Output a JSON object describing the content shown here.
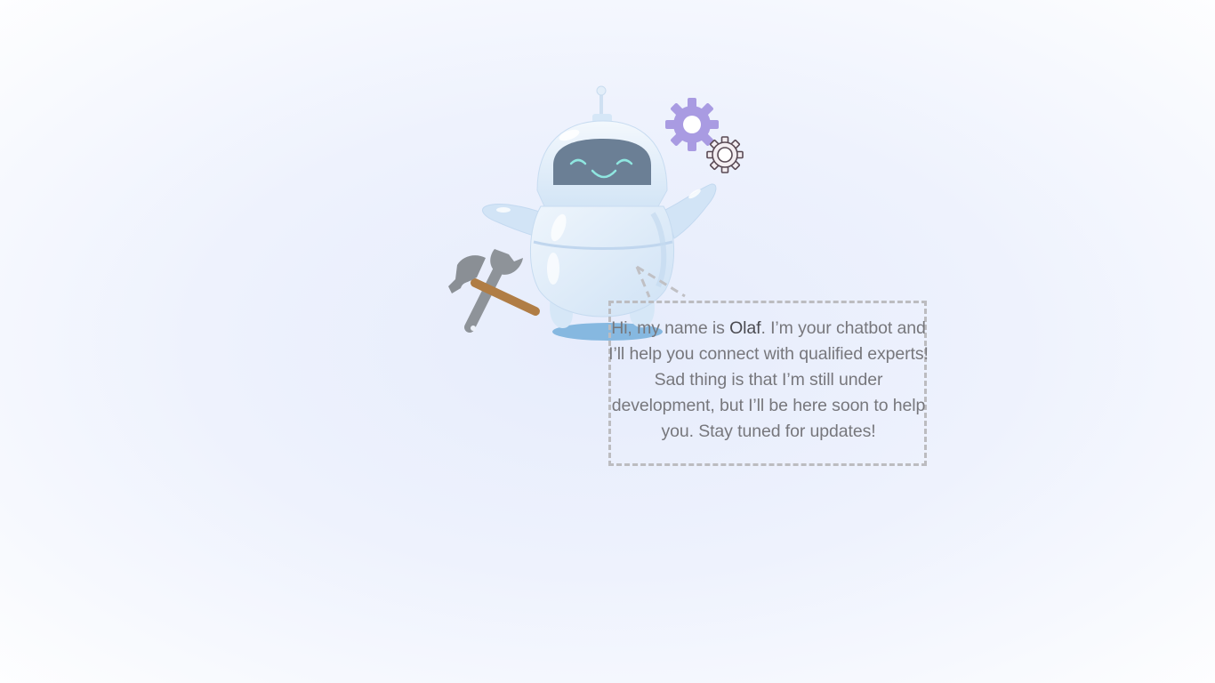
{
  "illustration": {
    "character": "robot",
    "icons": [
      "robot-icon",
      "gear-large-icon",
      "gear-small-icon",
      "hammer-icon",
      "wrench-icon"
    ],
    "colors": {
      "robot_body": "#dbe9f8",
      "robot_visor": "#6b7f95",
      "robot_face": "#8fe6e0",
      "gear_large": "#a99be2",
      "gear_small_outline": "#5a4a55",
      "shadow": "#7fb3dd",
      "hammer_handle": "#b07d45",
      "tools_metal": "#8e9399"
    }
  },
  "message": {
    "prefix": "Hi, my name is ",
    "bot_name": "Olaf",
    "body": ". I’m your chatbot and I’ll help you connect with qualified experts! Sad thing is that I’m still under development, but I’ll be here soon to help you. Stay tuned for updates!"
  }
}
